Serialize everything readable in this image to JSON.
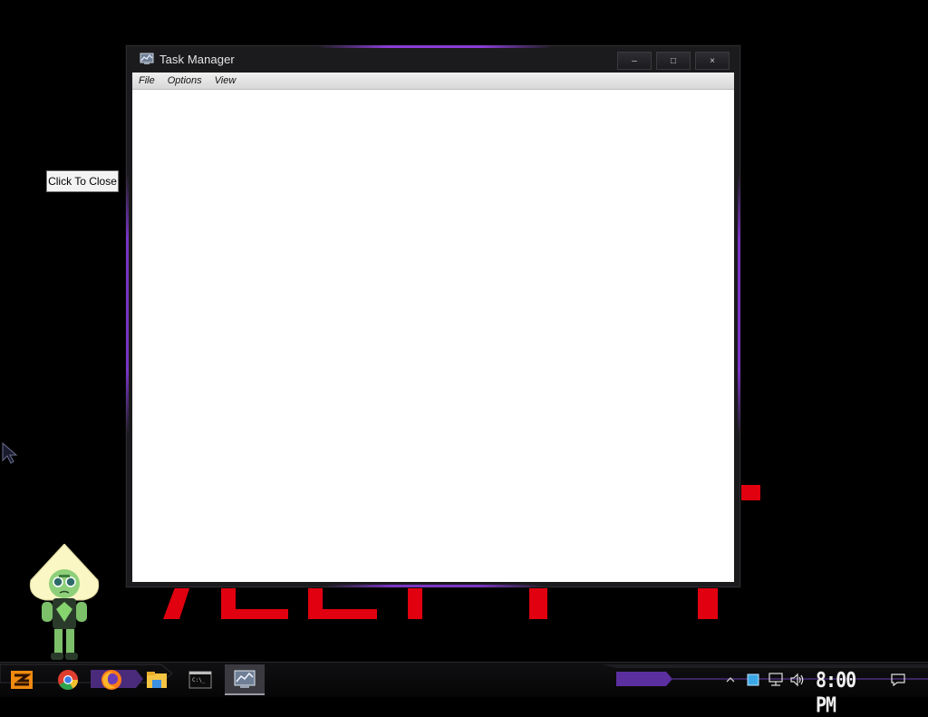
{
  "window": {
    "title": "Task Manager",
    "caption_buttons": {
      "minimize": "–",
      "maximize": "□",
      "close": "×"
    },
    "menu": [
      "File",
      "Options",
      "View"
    ]
  },
  "desktop": {
    "close_button_label": "Click To Close",
    "wallpaper_text": "ALERT",
    "accent_color": "#e0000f",
    "glow_color": "#7a34c4"
  },
  "taskbar": {
    "items": [
      {
        "name": "start-button-icon"
      },
      {
        "name": "chrome-icon"
      },
      {
        "name": "firefox-icon"
      },
      {
        "name": "file-explorer-icon"
      },
      {
        "name": "command-prompt-icon"
      },
      {
        "name": "task-manager-icon"
      }
    ],
    "tray": {
      "icons": [
        "show-hidden-icons-chevron",
        "app-tray-icon",
        "network-icon",
        "volume-icon",
        "notifications-icon"
      ]
    },
    "clock": "8:00 PM"
  }
}
